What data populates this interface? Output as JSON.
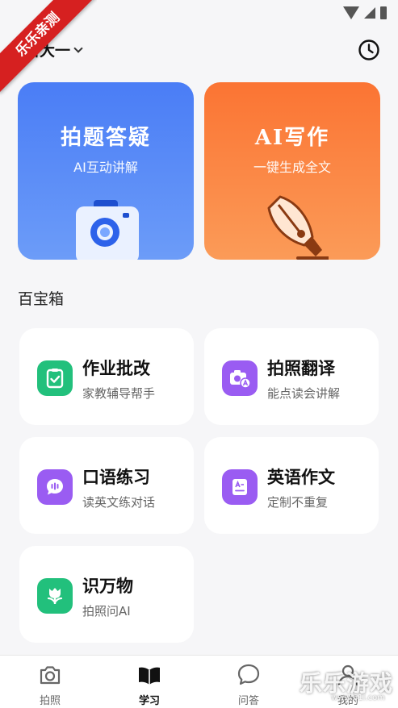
{
  "ribbon": "乐乐亲测",
  "header": {
    "grade": "新大一",
    "history_icon": "clock-icon"
  },
  "features": [
    {
      "title": "拍题答疑",
      "subtitle": "AI互动讲解",
      "icon": "camera-icon",
      "color": "#4a7df6"
    },
    {
      "title": "AI写作",
      "subtitle": "一键生成全文",
      "icon": "pen-nib-icon",
      "color": "#fb7433"
    }
  ],
  "toolbox": {
    "title": "百宝箱",
    "items": [
      {
        "title": "作业批改",
        "subtitle": "家教辅导帮手",
        "icon": "check-clipboard-icon"
      },
      {
        "title": "拍照翻译",
        "subtitle": "能点读会讲解",
        "icon": "camera-translate-icon"
      },
      {
        "title": "口语练习",
        "subtitle": "读英文练对话",
        "icon": "speech-bubble-icon"
      },
      {
        "title": "英语作文",
        "subtitle": "定制不重复",
        "icon": "english-document-icon"
      },
      {
        "title": "识万物",
        "subtitle": "拍照问AI",
        "icon": "tulip-icon"
      }
    ]
  },
  "nav": [
    {
      "label": "拍照",
      "icon": "camera-icon"
    },
    {
      "label": "学习",
      "icon": "book-icon",
      "active": true
    },
    {
      "label": "问答",
      "icon": "chat-bubble-icon"
    },
    {
      "label": "我的",
      "icon": "person-icon"
    }
  ],
  "watermark": {
    "text": "乐乐游戏",
    "url": "www.61l.com"
  }
}
